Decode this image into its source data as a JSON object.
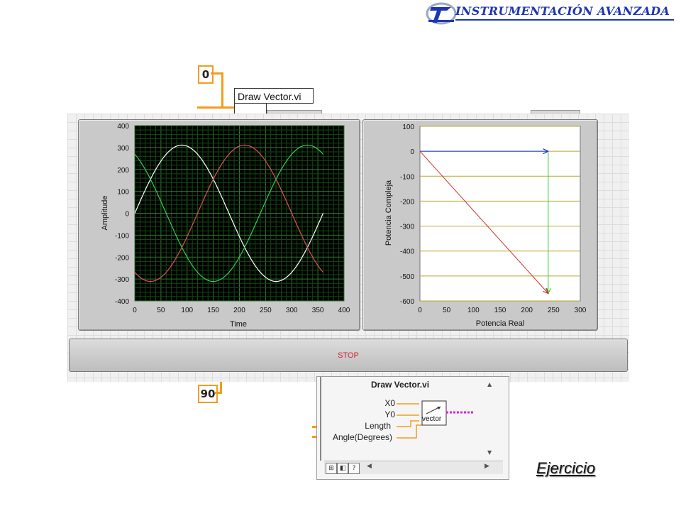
{
  "header": {
    "title": "INSTRUMENTACIÓN AVANZADA",
    "accent": "#1f36b3"
  },
  "block_diagram": {
    "const_top": "0",
    "const_bottom": "90",
    "subvi_label": "Draw Vector.vi",
    "wire_color": "#f39c1c"
  },
  "waveform_graph": {
    "xlabel": "Time",
    "ylabel": "Amplitude",
    "xticks": [
      "0",
      "50",
      "100",
      "150",
      "200",
      "250",
      "300",
      "350",
      "400"
    ],
    "yticks": [
      "400",
      "300",
      "200",
      "100",
      "0",
      "-100",
      "-200",
      "-300",
      "-400"
    ]
  },
  "xy_graph": {
    "xlabel": "Potencia Real",
    "ylabel": "Potencia Compleja",
    "xticks": [
      "0",
      "50",
      "100",
      "150",
      "200",
      "250",
      "300"
    ],
    "yticks": [
      "100",
      "0",
      "-100",
      "-200",
      "-300",
      "-400",
      "-500",
      "-600"
    ]
  },
  "stop_button": {
    "label": "STOP"
  },
  "context_help": {
    "title": "Draw Vector.vi",
    "terminals": [
      "X0",
      "Y0",
      "Length",
      "Angle(Degrees)"
    ],
    "output": "vector"
  },
  "footer": {
    "label": "Ejercicio"
  },
  "chart_data": [
    {
      "type": "line",
      "xlabel": "Time",
      "ylabel": "Amplitude",
      "xlim": [
        0,
        400
      ],
      "ylim": [
        -400,
        400
      ],
      "grid": true,
      "series": [
        {
          "color": "#ffffff",
          "amplitude": 311,
          "phase_deg": 0,
          "x": [
            0,
            360
          ]
        },
        {
          "color": "#e05050",
          "amplitude": 311,
          "phase_deg": -120,
          "x": [
            0,
            360
          ]
        },
        {
          "color": "#30d050",
          "amplitude": 311,
          "phase_deg": 120,
          "x": [
            0,
            360
          ]
        }
      ]
    },
    {
      "type": "line",
      "xlabel": "Potencia Real",
      "ylabel": "Potencia Compleja",
      "xlim": [
        0,
        300
      ],
      "ylim": [
        -600,
        100
      ],
      "grid": "horizontal",
      "series": [
        {
          "color": "#1030c0",
          "x": [
            0,
            240
          ],
          "y": [
            0,
            0
          ]
        },
        {
          "color": "#30d030",
          "x": [
            240,
            240
          ],
          "y": [
            0,
            -570
          ]
        },
        {
          "color": "#d03030",
          "x": [
            0,
            240
          ],
          "y": [
            0,
            -570
          ]
        }
      ]
    }
  ]
}
